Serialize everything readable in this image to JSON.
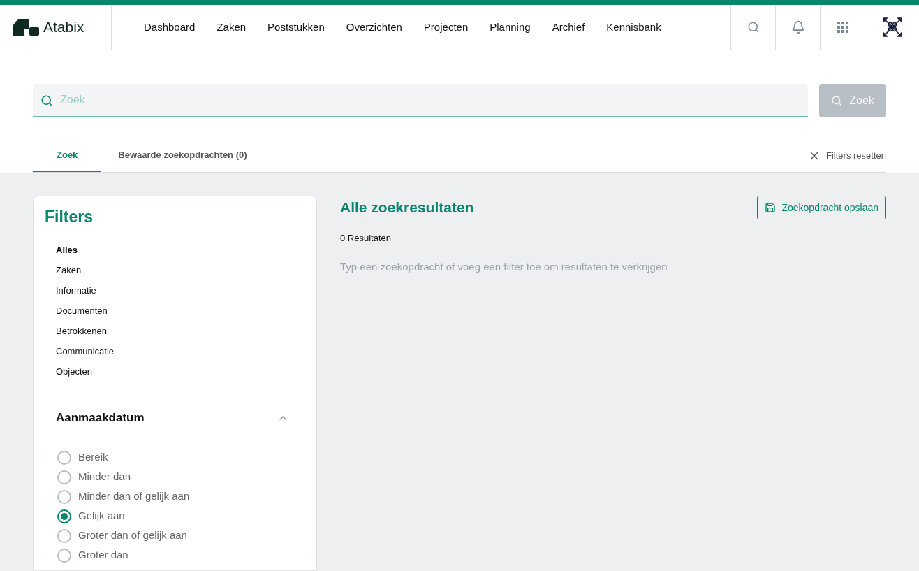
{
  "header": {
    "logo": "Atabix",
    "nav": [
      {
        "label": "Dashboard",
        "selected": false
      },
      {
        "label": "Zaken",
        "selected": false
      },
      {
        "label": "Poststukken",
        "selected": false
      },
      {
        "label": "Overzichten",
        "selected": false
      },
      {
        "label": "Projecten",
        "selected": false
      },
      {
        "label": "Planning",
        "selected": false
      },
      {
        "label": "Archief",
        "selected": false
      },
      {
        "label": "Kennisbank",
        "selected": false
      }
    ]
  },
  "search": {
    "placeholder": "Zoek",
    "button": "Zoek"
  },
  "tabs": [
    {
      "label": "Zoek",
      "selected": true
    },
    {
      "label": "Bewaarde zoekopdrachten (0)",
      "selected": false
    }
  ],
  "reset": "Filters resetten",
  "filters": {
    "title": "Filters",
    "categories": [
      {
        "label": "Alles",
        "selected": true
      },
      {
        "label": "Zaken",
        "selected": false
      },
      {
        "label": "Informatie",
        "selected": false
      },
      {
        "label": "Documenten",
        "selected": false
      },
      {
        "label": "Betrokkenen",
        "selected": false
      },
      {
        "label": "Communicatie",
        "selected": false
      },
      {
        "label": "Objecten",
        "selected": false
      }
    ],
    "section": {
      "title": "Aanmaakdatum",
      "expanded": true,
      "options": [
        {
          "label": "Bereik",
          "selected": false
        },
        {
          "label": "Minder dan",
          "selected": false
        },
        {
          "label": "Minder dan of gelijk aan",
          "selected": false
        },
        {
          "label": "Gelijk aan",
          "selected": true
        },
        {
          "label": "Groter dan of gelijk aan",
          "selected": false
        },
        {
          "label": "Groter dan",
          "selected": false
        }
      ]
    }
  },
  "results": {
    "title": "Alle zoekresultaten",
    "save": "Zoekopdracht opslaan",
    "count": "0 Resultaten",
    "empty": "Typ een zoekopdracht of voeg een filter toe om resultaten te verkrijgen"
  }
}
